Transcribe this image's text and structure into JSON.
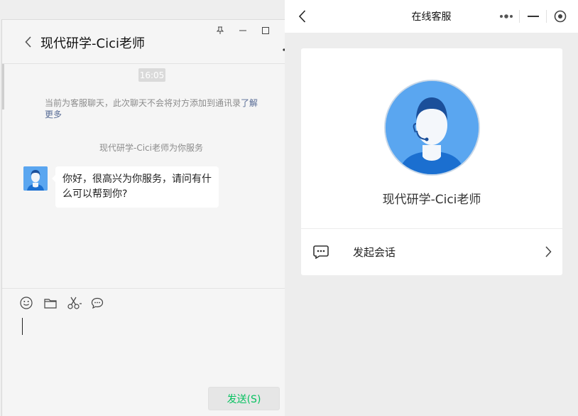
{
  "chat_window": {
    "title": "现代研学-Cici老师",
    "timestamp": "16:05",
    "notice_text": "当前为客服聊天，此次聊天不会将对方添加到通讯录",
    "notice_link": "了解更多",
    "service_text": "现代研学-Cici老师为你服务",
    "message": "你好，很高兴为你服务，请问有什么可以帮到你?",
    "send_label": "发送(S)",
    "input_value": ""
  },
  "panel": {
    "title": "在线客服",
    "profile_name": "现代研学-Cici老师",
    "start_label": "发起会话"
  },
  "icons": {
    "back": "chevron-left-icon",
    "pin": "pin-icon",
    "minimize": "minimize-icon",
    "maximize": "maximize-icon",
    "close": "close-icon",
    "more": "more-dots-icon",
    "emoji": "emoji-icon",
    "folder": "folder-icon",
    "screenshot": "scissors-icon",
    "chat": "chat-bubble-icon",
    "capsule_more": "more-dots-icon",
    "capsule_min": "minimize-icon",
    "capsule_close": "target-close-icon",
    "chevron_right": "chevron-right-icon"
  },
  "colors": {
    "send_text": "#07c160",
    "link": "#576b95",
    "avatar_blue": "#5aa6f0"
  }
}
